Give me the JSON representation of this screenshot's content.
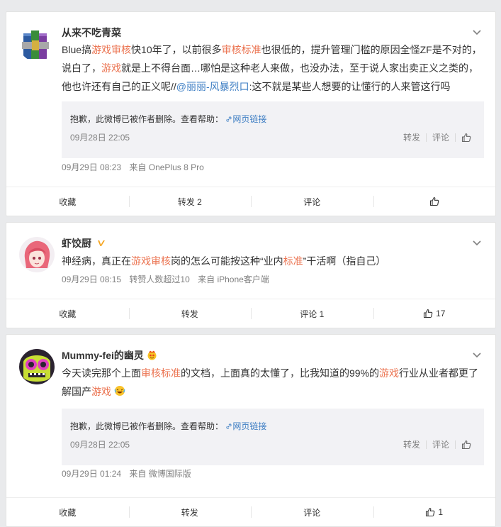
{
  "posts": [
    {
      "username": "从来不吃青菜",
      "content": {
        "t1": "Blue搞",
        "h1": "游戏审核",
        "t2": "快10年了，以前很多",
        "h2": "审核标准",
        "t3": "也很低的，提升管理门槛的原因全怪ZF是不对的，说白了，",
        "h3": "游戏",
        "t4": "就是上不得台面…哪怕是这种老人来做，也没办法，至于说人家出卖正义之类的，他也许还有自己的正义呢//",
        "at": "@丽丽-风暴烈口",
        "t5": ":这不就是某些人想要的让懂行的人来管这行吗"
      },
      "quote": {
        "text": "抱歉，此微博已被作者删除。查看帮助：",
        "link": "网页链接",
        "date": "09月28日 22:05",
        "repost": "转发",
        "comment": "评论"
      },
      "meta": {
        "time": "09月29日 08:23",
        "source": "来自 OnePlus 8 Pro"
      },
      "actions": {
        "fav": "收藏",
        "repost": "转发 2",
        "comment": "评论",
        "like": ""
      }
    },
    {
      "username": "虾饺厨",
      "content": {
        "t1": "神经病，真正在",
        "h1": "游戏审核",
        "t2": "岗的怎么可能按这种“业内",
        "h2": "标准",
        "t3": "”干活啊（指自己）"
      },
      "meta": {
        "time": "09月29日 08:15",
        "extra": "转赞人数超过10",
        "source": "来自 iPhone客户端"
      },
      "actions": {
        "fav": "收藏",
        "repost": "转发",
        "comment": "评论 1",
        "like": "17"
      }
    },
    {
      "username": "Mummy-fei的幽灵",
      "content": {
        "t1": "今天读完那个上面",
        "h1": "审核标准",
        "t2": "的文档，上面真的太懂了，比我知道的99%的",
        "h2": "游戏",
        "t3": "行业从业者都更了解国产",
        "h3": "游戏"
      },
      "quote": {
        "text": "抱歉，此微博已被作者删除。查看帮助：",
        "link": "网页链接",
        "date": "09月28日 22:05",
        "repost": "转发",
        "comment": "评论"
      },
      "meta": {
        "time": "09月29日 01:24",
        "source": "来自 微博国际版"
      },
      "actions": {
        "fav": "收藏",
        "repost": "转发",
        "comment": "评论",
        "like": "1"
      }
    }
  ],
  "colors": {
    "highlight": "#eb7350",
    "link": "#3f7fc4",
    "meta": "#808080",
    "verified": "#f5a623"
  },
  "icons": [
    "winrar-books-avatar",
    "anime-girl-avatar",
    "green-monster-avatar",
    "chevron-down-icon",
    "thumbs-up-icon",
    "verified-badge-icon",
    "link-icon",
    "laughing-emoji-icon",
    "crown-face-icon"
  ]
}
